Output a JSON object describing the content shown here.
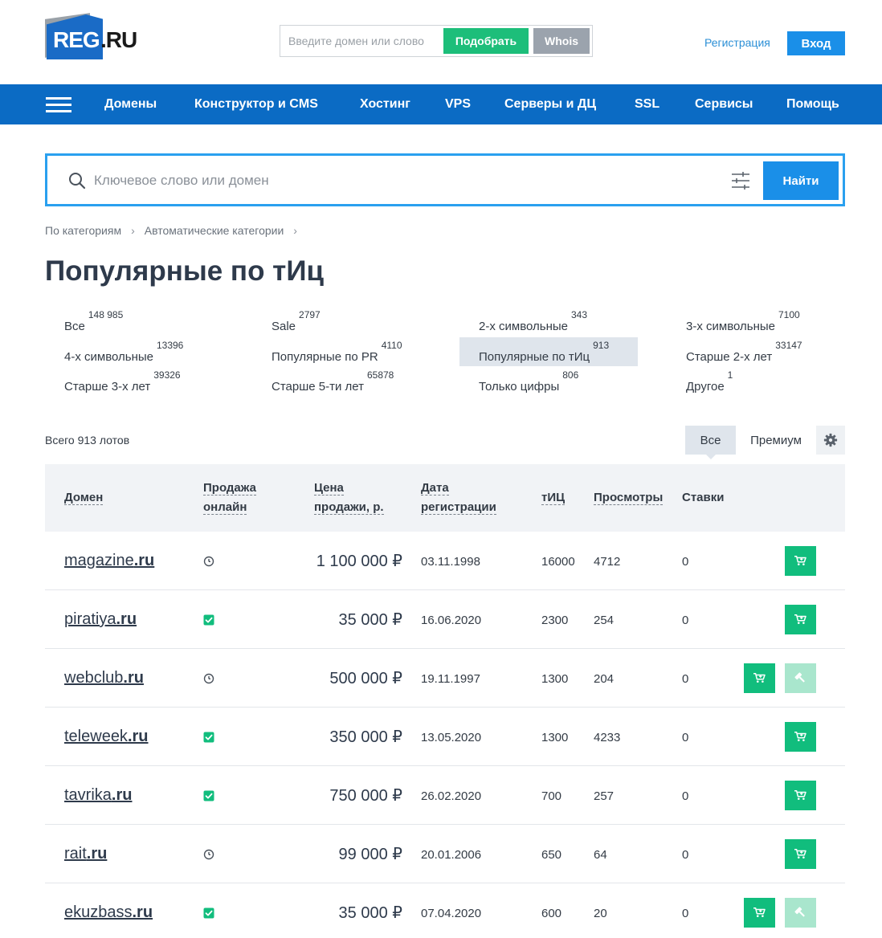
{
  "header": {
    "logo_main": "REG",
    "logo_suffix": ".RU",
    "search_placeholder": "Введите домен или слово",
    "pick_label": "Подобрать",
    "whois_label": "Whois",
    "register_label": "Регистрация",
    "login_label": "Вход"
  },
  "nav": {
    "items": [
      "Домены",
      "Конструктор и CMS",
      "Хостинг",
      "VPS",
      "Серверы и ДЦ",
      "SSL",
      "Сервисы",
      "Помощь"
    ]
  },
  "search": {
    "placeholder": "Ключевое слово или домен",
    "find_label": "Найти"
  },
  "breadcrumb": [
    "По категориям",
    "Автоматические категории"
  ],
  "page_title": "Популярные по тИц",
  "categories": [
    {
      "label": "Все",
      "count": "148 985"
    },
    {
      "label": "Sale",
      "count": "2797"
    },
    {
      "label": "2-х символьные",
      "count": "343"
    },
    {
      "label": "3-х символьные",
      "count": "7100"
    },
    {
      "label": "4-х символьные",
      "count": "13396"
    },
    {
      "label": "Популярные по PR",
      "count": "4110"
    },
    {
      "label": "Популярные по тИц",
      "count": "913"
    },
    {
      "label": "Старше 2-х лет",
      "count": "33147"
    },
    {
      "label": "Старше 3-х лет",
      "count": "39326"
    },
    {
      "label": "Старше 5-ти лет",
      "count": "65878"
    },
    {
      "label": "Только цифры",
      "count": "806"
    },
    {
      "label": "Другое",
      "count": "1"
    }
  ],
  "listing": {
    "total": "Всего 913 лотов",
    "tab_all": "Все",
    "tab_premium": "Премиум"
  },
  "table": {
    "headers": {
      "domain": "Домен",
      "online_1": "Продажа",
      "online_2": "онлайн",
      "price_1": "Цена",
      "price_2": "продажи, р.",
      "date_1": "Дата",
      "date_2": "регистрации",
      "tic": "тИЦ",
      "views": "Просмотры",
      "bids": "Ставки"
    },
    "rows": [
      {
        "name": "magazine",
        "tld": ".ru",
        "status": "clock",
        "price": "1 100 000 ₽",
        "date": "03.11.1998",
        "tic": "16000",
        "views": "4712",
        "bids": "0",
        "auction": false
      },
      {
        "name": "piratiya",
        "tld": ".ru",
        "status": "check",
        "price": "35 000 ₽",
        "date": "16.06.2020",
        "tic": "2300",
        "views": "254",
        "bids": "0",
        "auction": false
      },
      {
        "name": "webclub",
        "tld": ".ru",
        "status": "clock",
        "price": "500 000 ₽",
        "date": "19.11.1997",
        "tic": "1300",
        "views": "204",
        "bids": "0",
        "auction": true
      },
      {
        "name": "teleweek",
        "tld": ".ru",
        "status": "check",
        "price": "350 000 ₽",
        "date": "13.05.2020",
        "tic": "1300",
        "views": "4233",
        "bids": "0",
        "auction": false
      },
      {
        "name": "tavrika",
        "tld": ".ru",
        "status": "check",
        "price": "750 000 ₽",
        "date": "26.02.2020",
        "tic": "700",
        "views": "257",
        "bids": "0",
        "auction": false
      },
      {
        "name": "rait",
        "tld": ".ru",
        "status": "clock",
        "price": "99 000 ₽",
        "date": "20.01.2006",
        "tic": "650",
        "views": "64",
        "bids": "0",
        "auction": false
      },
      {
        "name": "ekuzbass",
        "tld": ".ru",
        "status": "check",
        "price": "35 000 ₽",
        "date": "07.04.2020",
        "tic": "600",
        "views": "20",
        "bids": "0",
        "auction": true
      }
    ]
  },
  "colors": {
    "brand_blue": "#0b6bc4",
    "accent_blue": "#1a8fe8",
    "green": "#11bd7d",
    "green_light": "#a9e6cd",
    "whois_gray": "#9ba3ad"
  }
}
